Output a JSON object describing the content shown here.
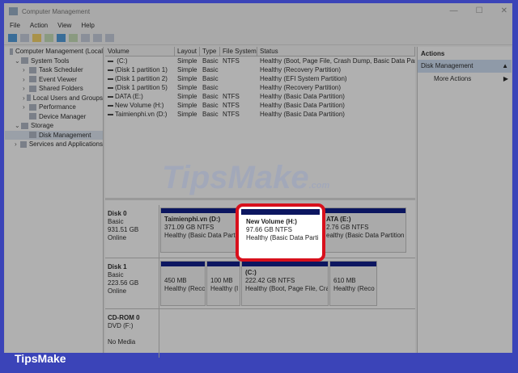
{
  "window": {
    "title": "Computer Management",
    "controls": [
      "—",
      "☐",
      "✕"
    ]
  },
  "menu": [
    "File",
    "Action",
    "View",
    "Help"
  ],
  "tree": [
    {
      "label": "Computer Management (Local",
      "level": 0
    },
    {
      "label": "System Tools",
      "level": 1,
      "arrow": "⌄"
    },
    {
      "label": "Task Scheduler",
      "level": 2,
      "arrow": "›"
    },
    {
      "label": "Event Viewer",
      "level": 2,
      "arrow": "›"
    },
    {
      "label": "Shared Folders",
      "level": 2,
      "arrow": "›"
    },
    {
      "label": "Local Users and Groups",
      "level": 2,
      "arrow": "›"
    },
    {
      "label": "Performance",
      "level": 2,
      "arrow": "›"
    },
    {
      "label": "Device Manager",
      "level": 2,
      "arrow": ""
    },
    {
      "label": "Storage",
      "level": 1,
      "arrow": "⌄"
    },
    {
      "label": "Disk Management",
      "level": 2,
      "arrow": "",
      "selected": true
    },
    {
      "label": "Services and Applications",
      "level": 1,
      "arrow": "›"
    }
  ],
  "volumes": {
    "headers": [
      "Volume",
      "Layout",
      "Type",
      "File System",
      "Status"
    ],
    "rows": [
      [
        " (C:)",
        "Simple",
        "Basic",
        "NTFS",
        "Healthy (Boot, Page File, Crash Dump, Basic Data Partiti"
      ],
      [
        "(Disk 1 partition 1)",
        "Simple",
        "Basic",
        "",
        "Healthy (Recovery Partition)"
      ],
      [
        "(Disk 1 partition 2)",
        "Simple",
        "Basic",
        "",
        "Healthy (EFI System Partition)"
      ],
      [
        "(Disk 1 partition 5)",
        "Simple",
        "Basic",
        "",
        "Healthy (Recovery Partition)"
      ],
      [
        "DATA (E:)",
        "Simple",
        "Basic",
        "NTFS",
        "Healthy (Basic Data Partition)"
      ],
      [
        "New Volume (H:)",
        "Simple",
        "Basic",
        "NTFS",
        "Healthy (Basic Data Partition)"
      ],
      [
        "Taimienphi.vn (D:)",
        "Simple",
        "Basic",
        "NTFS",
        "Healthy (Basic Data Partition)"
      ]
    ]
  },
  "watermark": "TipsMake.com",
  "disks": [
    {
      "name": "Disk 0",
      "lines": [
        "Basic",
        "931.51 GB",
        "Online"
      ]
    },
    {
      "name": "Disk 1",
      "lines": [
        "Basic",
        "223.56 GB",
        "Online"
      ]
    },
    {
      "name": "CD-ROM 0",
      "lines": [
        "DVD (F:)",
        "",
        "No Media"
      ]
    }
  ],
  "partitions": {
    "d0p1": {
      "name": "Taimienphi.vn  (D:)",
      "size": "371.09 GB NTFS",
      "status": "Healthy (Basic Data Partiti"
    },
    "d0p2": {
      "name": "New Volume  (H:)",
      "size": "97.66 GB NTFS",
      "status": "Healthy (Basic Data Parti"
    },
    "d0p3": {
      "name": "ATA  (E:)",
      "size": "2.76 GB NTFS",
      "status": "ealthy (Basic Data Partition"
    },
    "d1p1": {
      "name": "",
      "size": "450 MB",
      "status": "Healthy (Recc"
    },
    "d1p2": {
      "name": "",
      "size": "100 MB",
      "status": "Healthy (I"
    },
    "d1p3": {
      "name": "(C:)",
      "size": "222.42 GB NTFS",
      "status": "Healthy (Boot, Page File, Crash"
    },
    "d1p4": {
      "name": "",
      "size": "610 MB",
      "status": "Healthy (Reco"
    }
  },
  "actions": {
    "title": "Actions",
    "section": "Disk Management",
    "section_arrow": "▲",
    "item": "More Actions",
    "item_arrow": "▶"
  },
  "banner": "TipsMake"
}
